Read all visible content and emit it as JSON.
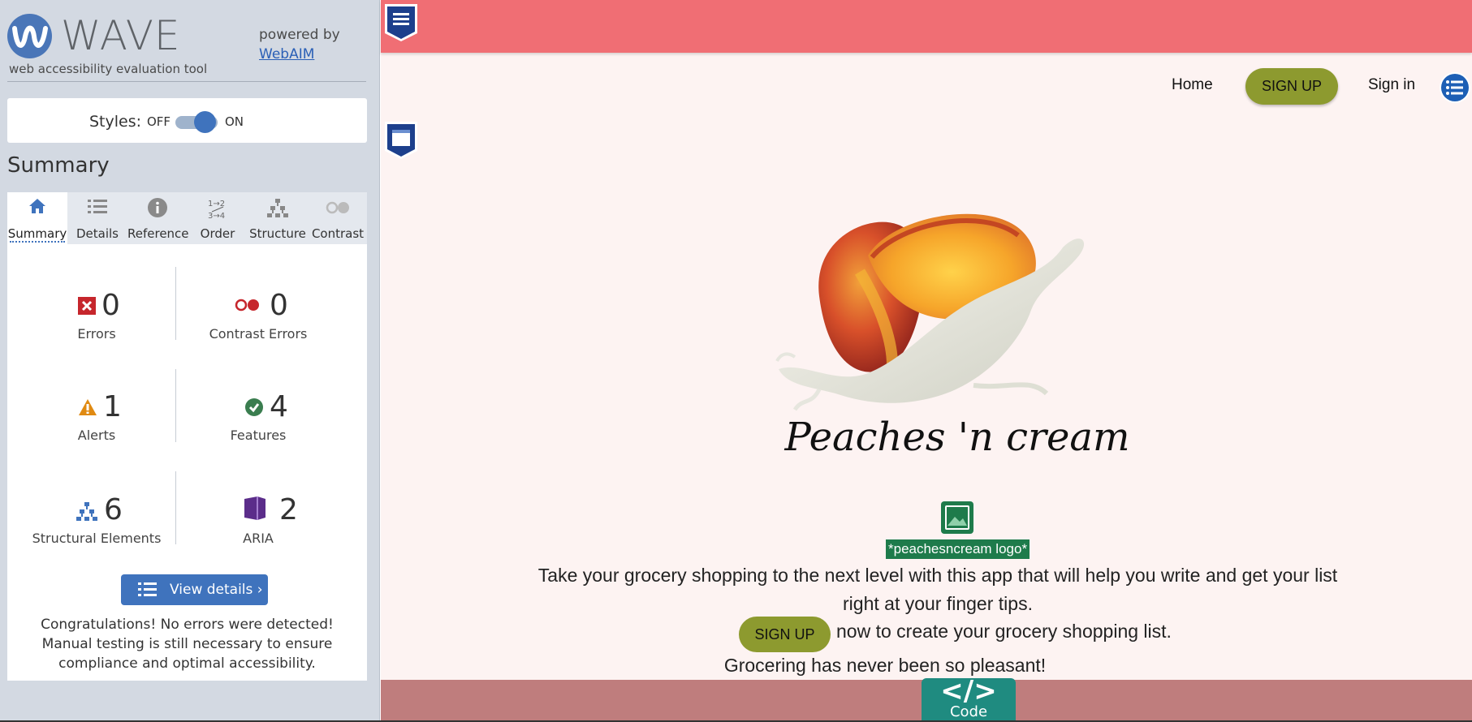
{
  "wave": {
    "title": "WAVE",
    "subtitle": "web accessibility evaluation tool",
    "powered_by": "powered by",
    "webaim_link": "WebAIM",
    "styles": {
      "label": "Styles:",
      "off": "OFF",
      "on": "ON",
      "state": "on"
    },
    "summary_heading": "Summary",
    "tabs": [
      {
        "label": "Summary",
        "icon": "home-icon",
        "active": true
      },
      {
        "label": "Details",
        "icon": "list-icon"
      },
      {
        "label": "Reference",
        "icon": "info-icon"
      },
      {
        "label": "Order",
        "icon": "order-icon",
        "icon_text": "1→2 3→4"
      },
      {
        "label": "Structure",
        "icon": "structure-icon"
      },
      {
        "label": "Contrast",
        "icon": "contrast-icon"
      }
    ],
    "stats": {
      "errors": {
        "count": "0",
        "label": "Errors",
        "icon": "error-icon",
        "color": "#c6262c"
      },
      "contrast_errors": {
        "count": "0",
        "label": "Contrast Errors",
        "icon": "contrast-error-icon",
        "color": "#c6262c"
      },
      "alerts": {
        "count": "1",
        "label": "Alerts",
        "icon": "alert-icon",
        "color": "#e08a12"
      },
      "features": {
        "count": "4",
        "label": "Features",
        "icon": "feature-check-icon",
        "color": "#3a7d4f"
      },
      "structural": {
        "count": "6",
        "label": "Structural Elements",
        "icon": "structure-icon",
        "color": "#3f73bd"
      },
      "aria": {
        "count": "2",
        "label": "ARIA",
        "icon": "aria-icon",
        "color": "#5b2d8a"
      }
    },
    "view_details_label": "View details ›",
    "congrats": "Congratulations! No errors were detected! Manual testing is still necessary to ensure compliance and optimal accessibility."
  },
  "page": {
    "nav": {
      "home": "Home",
      "signup": "SIGN UP",
      "signin": "Sign in"
    },
    "logo_script": "Peaches 'n cream",
    "alt_tag": "*peachesncream logo*",
    "tagline": "Take your grocery shopping to the next level with this app that will help you write and get your list right at your finger tips.",
    "signup_button": "SIGN UP",
    "signup_line": "now to create your grocery shopping list.",
    "pleasant_line": "Grocering has never been so pleasant!",
    "code_tab": {
      "glyph": "</>",
      "label": "Code"
    },
    "colors": {
      "banner": "#f06e74",
      "background": "#fdf3f2",
      "button": "#8d9a2f",
      "footer_band": "#bf7d7d",
      "code_tab": "#1f8b80"
    }
  }
}
